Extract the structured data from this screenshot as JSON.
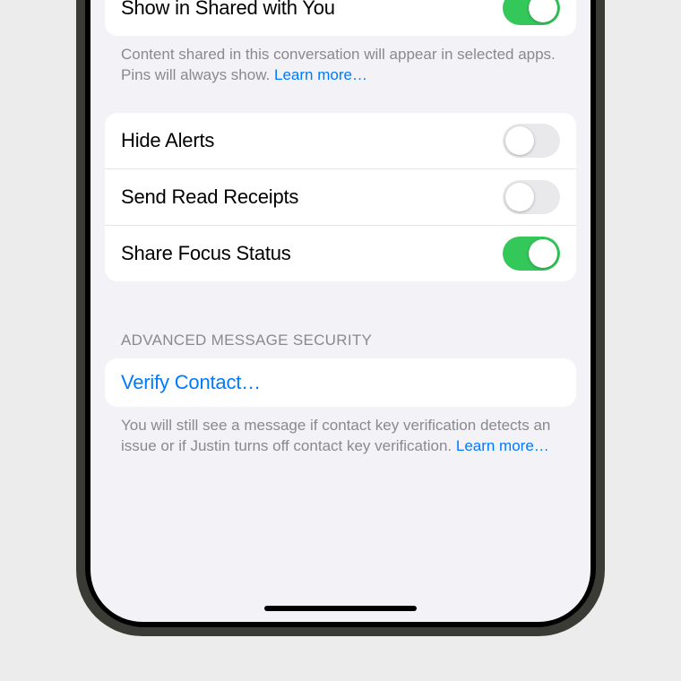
{
  "sharedWithYou": {
    "label": "Show in Shared with You",
    "on": true,
    "footer": "Content shared in this conversation will appear in selected apps. Pins will always show. ",
    "learnMore": "Learn more…"
  },
  "toggles": {
    "hideAlerts": {
      "label": "Hide Alerts",
      "on": false
    },
    "readReceipts": {
      "label": "Send Read Receipts",
      "on": false
    },
    "focusStatus": {
      "label": "Share Focus Status",
      "on": true
    }
  },
  "security": {
    "header": "ADVANCED MESSAGE SECURITY",
    "verify": "Verify Contact…",
    "footer": "You will still see a message if contact key verification detects an issue or if Justin turns off contact key verification. ",
    "learnMore": "Learn more…"
  }
}
